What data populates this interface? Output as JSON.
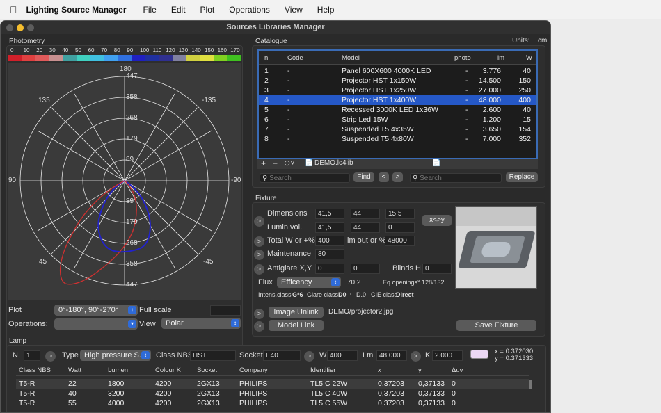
{
  "menubar": {
    "app_name": "Lighting Source Manager",
    "items": [
      "File",
      "Edit",
      "Plot",
      "Operations",
      "View",
      "Help"
    ]
  },
  "window": {
    "title": "Sources Libraries Manager",
    "units_label": "Units:",
    "units_value": "cm"
  },
  "photometry": {
    "title": "Photometry",
    "scale_ticks": [
      "0",
      "10",
      "20",
      "30",
      "40",
      "50",
      "60",
      "70",
      "80",
      "90",
      "100",
      "110",
      "120",
      "130",
      "140",
      "150",
      "160",
      "170"
    ],
    "scale_colors": [
      "#d0202a",
      "#e04040",
      "#e05a5a",
      "#c89090",
      "#40a0a0",
      "#40d0c0",
      "#40c0e0",
      "#40a0f0",
      "#3070e0",
      "#2020c0",
      "#2030a0",
      "#303090",
      "#8080a0",
      "#d0d040",
      "#e0e040",
      "#80d020",
      "#40c020"
    ],
    "angle_labels": {
      "top": "180",
      "tl": "135",
      "tr": "-135",
      "left": "90",
      "right": "-90",
      "bl": "45",
      "br": "-45"
    },
    "radial_top": [
      "447",
      "358",
      "268",
      "179",
      "89"
    ],
    "radial_bottom": [
      "89",
      "179",
      "268",
      "358",
      "447"
    ],
    "plot_label": "Plot",
    "plot_value": "0°-180°, 90°-270°",
    "full_scale": "Full scale",
    "operations_label": "Operations:",
    "operations_value": "",
    "view_label": "View",
    "view_value": "Polar"
  },
  "catalogue": {
    "title": "Catalogue",
    "headers": [
      "n.",
      "Code",
      "Model",
      "photo",
      "lm",
      "W"
    ],
    "rows": [
      [
        "1",
        "-",
        "Panel 600X600 4000K LED",
        "-",
        "3.776",
        "40"
      ],
      [
        "2",
        "-",
        "Projector HST 1x150W",
        "-",
        "14.500",
        "150"
      ],
      [
        "3",
        "-",
        "Projector HST 1x250W",
        "-",
        "27.000",
        "250"
      ],
      [
        "4",
        "-",
        "Projector HST 1x400W",
        "-",
        "48.000",
        "400"
      ],
      [
        "5",
        "-",
        "Recessed 3000K LED 1x36W",
        "-",
        "2.600",
        "40"
      ],
      [
        "6",
        "-",
        "Strip Led 15W",
        "-",
        "1.200",
        "15"
      ],
      [
        "7",
        "-",
        "Suspended T5  4x35W",
        "-",
        "3.650",
        "154"
      ],
      [
        "8",
        "-",
        "Suspended T5  4x80W",
        "-",
        "7.000",
        "352"
      ]
    ],
    "selected_index": 3,
    "file_name": "DEMO.lc4lib",
    "search_placeholder": "Search",
    "find_label": "Find",
    "prev_label": "<",
    "next_label": ">",
    "replace_placeholder": "Search",
    "replace_label": "Replace"
  },
  "fixture": {
    "title": "Fixture",
    "dimensions_label": "Dimensions",
    "dimensions": [
      "41,5",
      "44",
      "15,5"
    ],
    "lumin_label": "Lumin.vol.",
    "lumin": [
      "41,5",
      "44",
      "0"
    ],
    "swap_label": "x<>y",
    "total_label": "Total W or +%",
    "total_value": "400",
    "imout_label": "lm out or %",
    "imout_value": "48000",
    "maintenance_label": "Maintenance",
    "maintenance_value": "80",
    "antiglare_label": "Antiglare X,Y",
    "antiglare": [
      "0",
      "0"
    ],
    "blinds_label": "Blinds H.",
    "blinds_value": "0",
    "flux_label": "Flux",
    "flux_value": "Efficency",
    "flux_number": "70,2",
    "eq_label": "Eq.openings°",
    "eq_value": "128/132",
    "intens_label": "Intens.class",
    "intens_value": "G*6",
    "glare_label": "Glare class",
    "glare_value": "D0",
    "dmark": "D.0",
    "cie_label": "CIE class",
    "cie_value": "Direct",
    "image_unlink_label": "Image Unlink",
    "image_path": "DEMO/projector2.jpg",
    "model_link_label": "Model Link",
    "save_label": "Save Fixture"
  },
  "lamp": {
    "title": "Lamp",
    "n_label": "N.",
    "n_value": "1",
    "type_label": "Type",
    "type_value": "High pressure S...",
    "class_label": "Class NBS",
    "class_value": "HST",
    "socket_label": "Socket",
    "socket_value": "E40",
    "w_label": "W",
    "w_value": "400",
    "lm_label": "Lm",
    "lm_value": "48.000",
    "k_label": "K",
    "k_value": "2.000",
    "swatch_color": "#ecd8f4",
    "x_coord": "x = 0.372030",
    "y_coord": "y = 0.371333",
    "headers": [
      "Class NBS",
      "Watt",
      "Lumen",
      "Colour K",
      "Socket",
      "Company",
      "Identifier",
      "x",
      "y",
      "Δuv"
    ],
    "rows": [
      [
        "T5-R",
        "22",
        "1800",
        "4200",
        "2GX13",
        "PHILIPS",
        "TL5 C 22W",
        "0,37203",
        "0,37133",
        "0"
      ],
      [
        "T5-R",
        "40",
        "3200",
        "4200",
        "2GX13",
        "PHILIPS",
        "TL5 C 40W",
        "0,37203",
        "0,37133",
        "0"
      ],
      [
        "T5-R",
        "55",
        "4000",
        "4200",
        "2GX13",
        "PHILIPS",
        "TL5 C 55W",
        "0,37203",
        "0,37133",
        "0"
      ]
    ]
  }
}
